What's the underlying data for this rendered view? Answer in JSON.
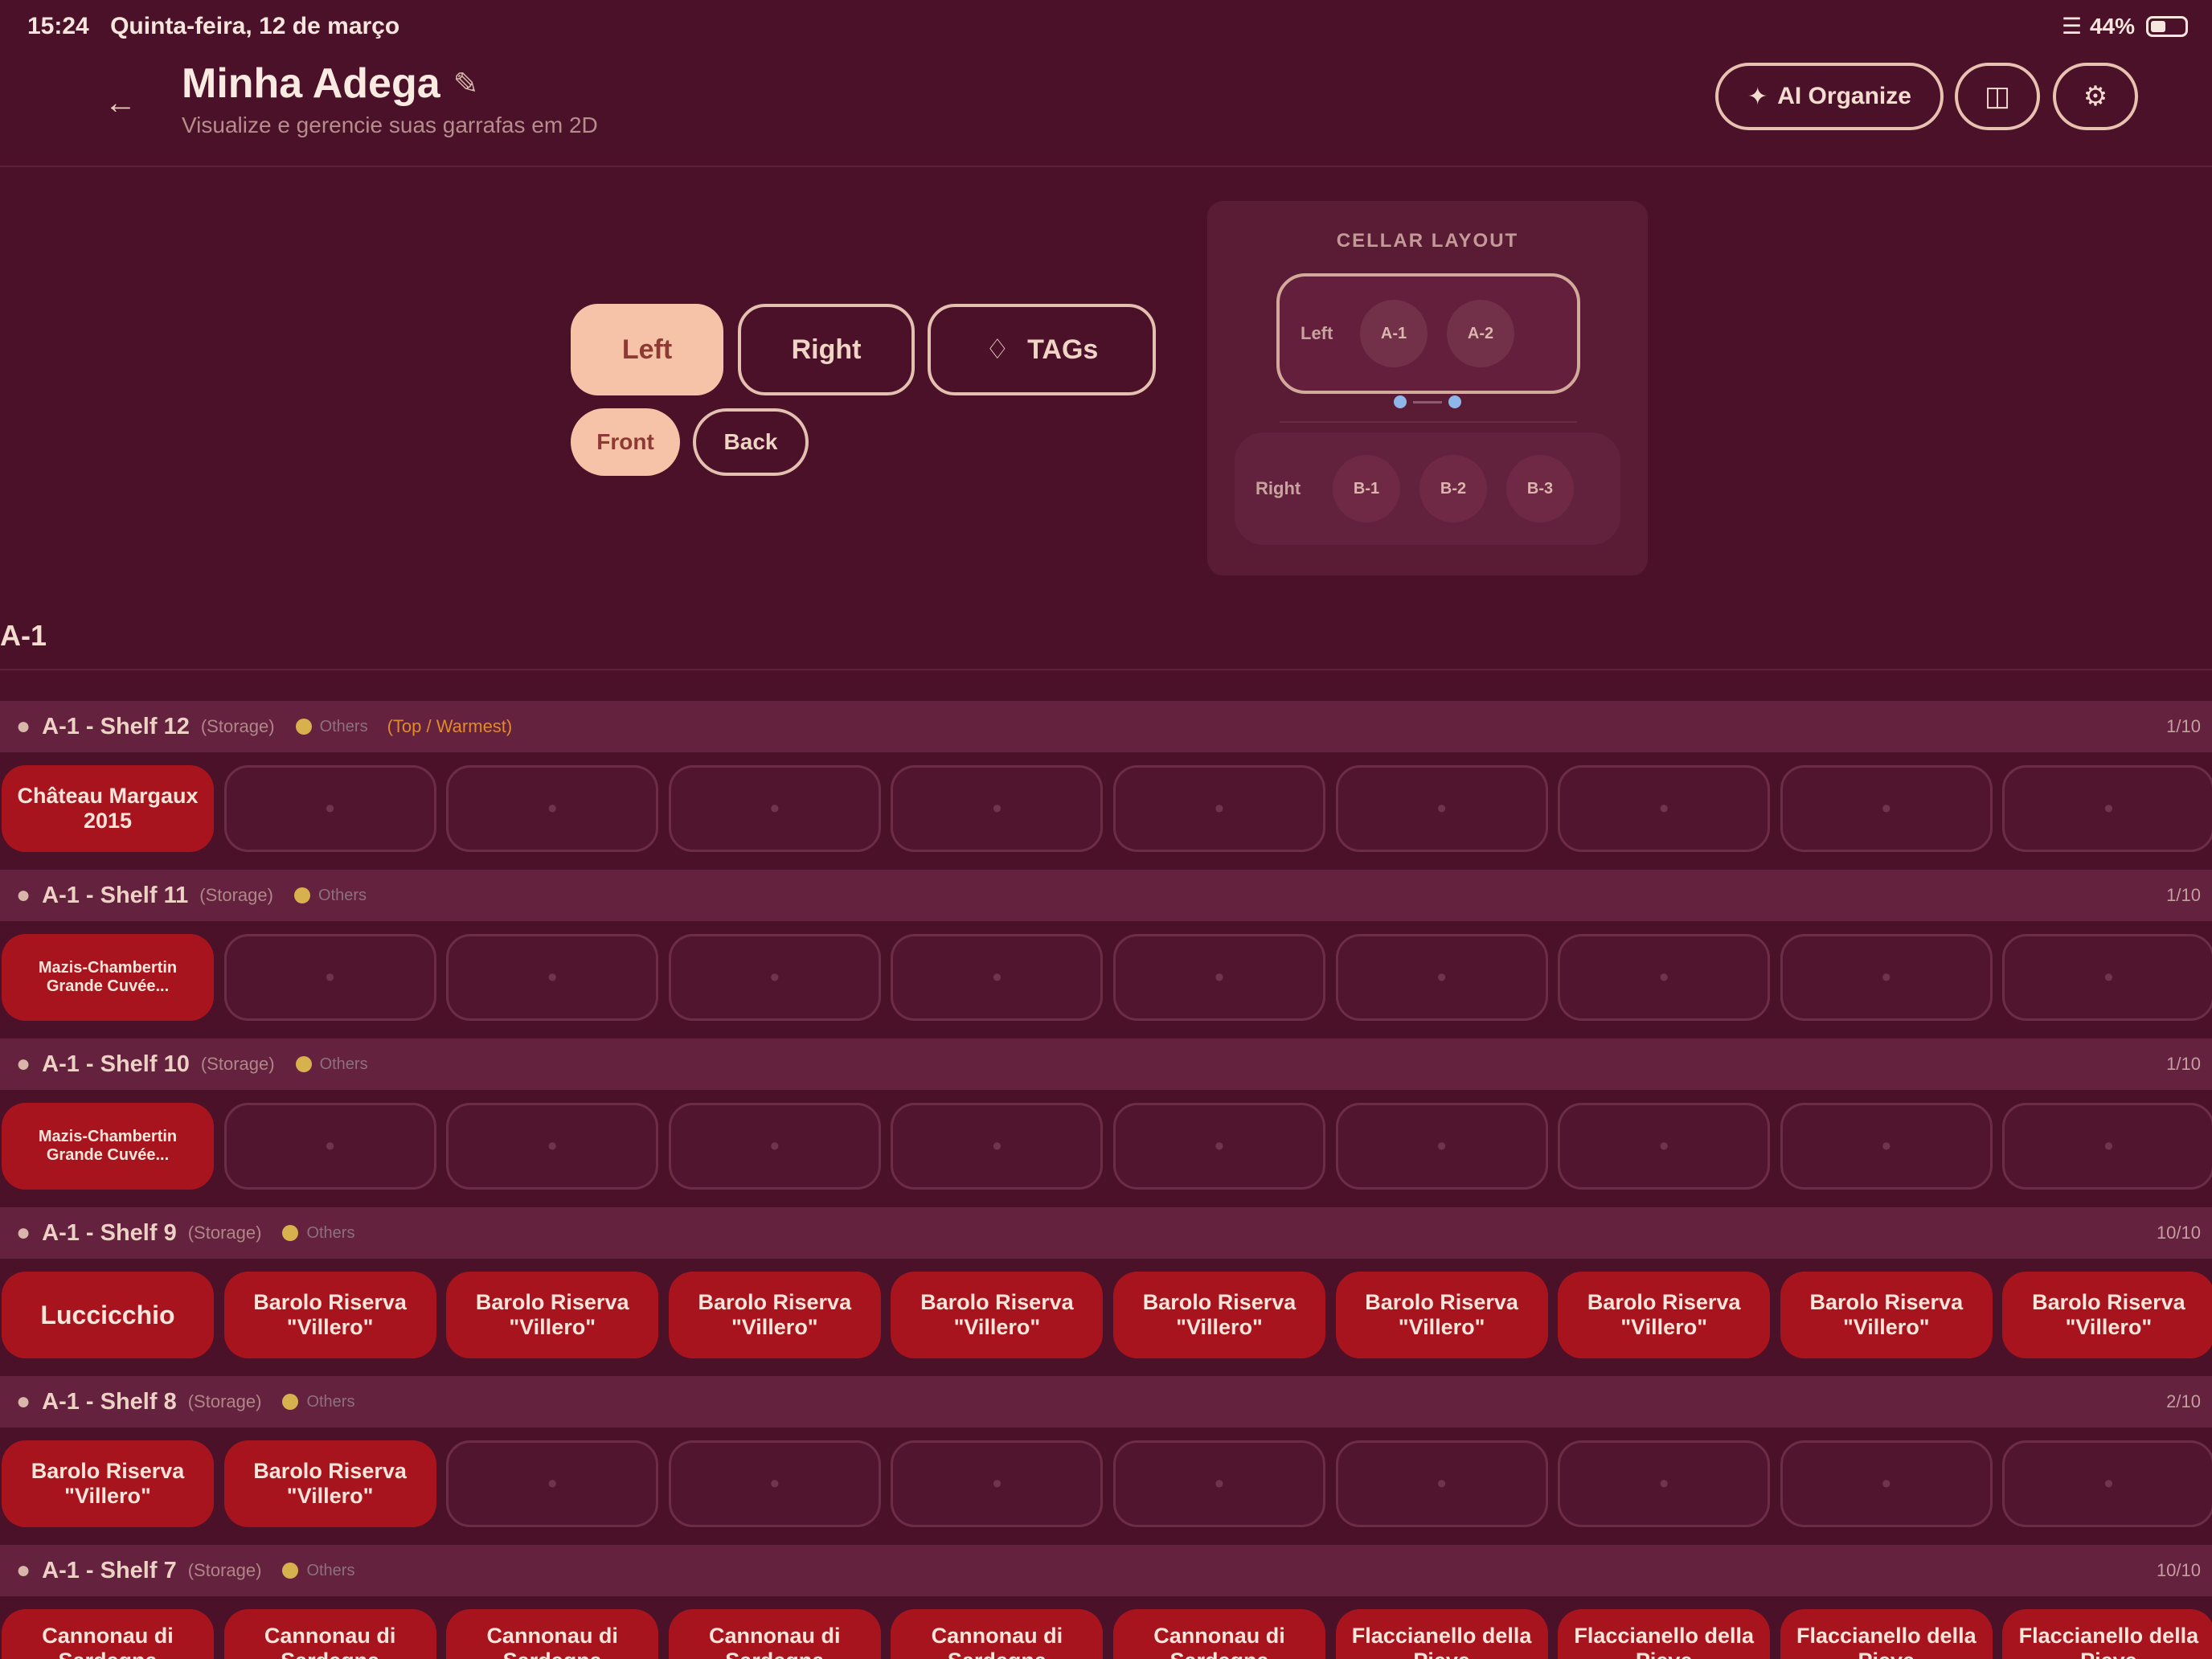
{
  "status_bar": {
    "time": "15:24",
    "date": "Quinta-feira, 12 de março",
    "battery": "44%"
  },
  "header": {
    "title": "Minha Adega",
    "subtitle": "Visualize e gerencie suas garrafas em 2D",
    "ai_button": "AI Organize",
    "ai_icon": "sparkle-icon",
    "icon_button_1": "cube-icon",
    "icon_button_2": "gear-icon"
  },
  "view_controls": {
    "sides": [
      {
        "label": "Left",
        "active": true
      },
      {
        "label": "Right",
        "active": false
      }
    ],
    "tags_label": "TAGs",
    "depth": [
      {
        "label": "Front",
        "active": true
      },
      {
        "label": "Back",
        "active": false
      }
    ]
  },
  "cellar_layout": {
    "title": "CELLAR LAYOUT",
    "left": {
      "label": "Left",
      "units": [
        "A-1",
        "A-2"
      ]
    },
    "right": {
      "label": "Right",
      "units": [
        "B-1",
        "B-2",
        "B-3"
      ]
    }
  },
  "section": {
    "label": "A-1"
  },
  "shelves": [
    {
      "name": "A-1 - Shelf 12",
      "type": "(Storage)",
      "tag": "Others",
      "warning": "(Top / Warmest)",
      "count": "1/10",
      "slots": [
        "Château Margaux 2015",
        "",
        "",
        "",
        "",
        "",
        "",
        "",
        "",
        ""
      ]
    },
    {
      "name": "A-1 - Shelf 11",
      "type": "(Storage)",
      "tag": "Others",
      "warning": "",
      "count": "1/10",
      "slots": [
        "Mazis-Chambertin Grande Cuvée...",
        "",
        "",
        "",
        "",
        "",
        "",
        "",
        "",
        ""
      ]
    },
    {
      "name": "A-1 - Shelf 10",
      "type": "(Storage)",
      "tag": "Others",
      "warning": "",
      "count": "1/10",
      "slots": [
        "Mazis-Chambertin Grande Cuvée...",
        "",
        "",
        "",
        "",
        "",
        "",
        "",
        "",
        ""
      ]
    },
    {
      "name": "A-1 - Shelf 9",
      "type": "(Storage)",
      "tag": "Others",
      "warning": "",
      "count": "10/10",
      "slots": [
        "Luccicchio",
        "Barolo Riserva \"Villero\"",
        "Barolo Riserva \"Villero\"",
        "Barolo Riserva \"Villero\"",
        "Barolo Riserva \"Villero\"",
        "Barolo Riserva \"Villero\"",
        "Barolo Riserva \"Villero\"",
        "Barolo Riserva \"Villero\"",
        "Barolo Riserva \"Villero\"",
        "Barolo Riserva \"Villero\""
      ]
    },
    {
      "name": "A-1 - Shelf 8",
      "type": "(Storage)",
      "tag": "Others",
      "warning": "",
      "count": "2/10",
      "slots": [
        "Barolo Riserva \"Villero\"",
        "Barolo Riserva \"Villero\"",
        "",
        "",
        "",
        "",
        "",
        "",
        "",
        ""
      ]
    },
    {
      "name": "A-1 - Shelf 7",
      "type": "(Storage)",
      "tag": "Others",
      "warning": "",
      "count": "10/10",
      "slots": [
        "Cannonau di Sardegna",
        "Cannonau di Sardegna",
        "Cannonau di Sardegna",
        "Cannonau di Sardegna",
        "Cannonau di Sardegna",
        "Cannonau di Sardegna",
        "Flaccianello della Pieve",
        "Flaccianello della Pieve",
        "Flaccianello della Pieve",
        "Flaccianello della Pieve"
      ]
    }
  ]
}
